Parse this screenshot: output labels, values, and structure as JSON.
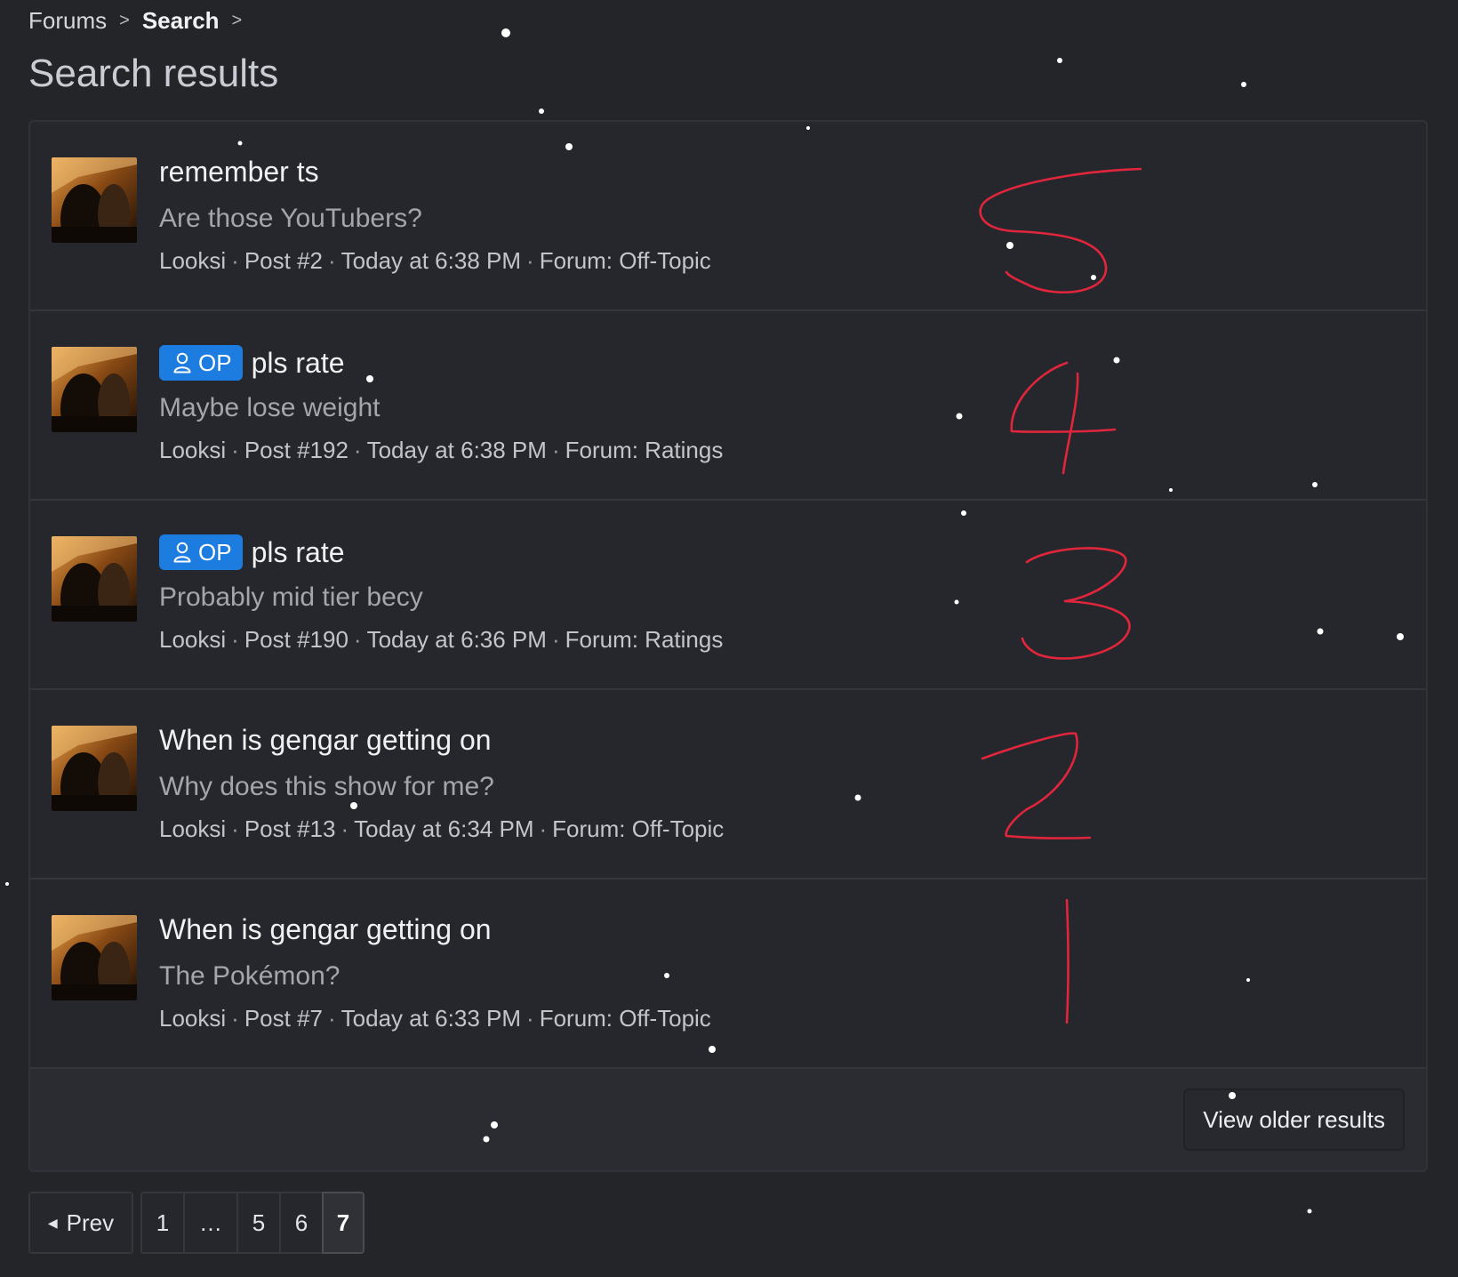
{
  "breadcrumb": {
    "items": [
      "Forums",
      "Search"
    ],
    "separator": ">"
  },
  "page": {
    "title": "Search results"
  },
  "results": [
    {
      "title": "remember ts",
      "op": false,
      "snippet": "Are those YouTubers?",
      "author": "Looksi",
      "post": "Post #2",
      "time": "Today at 6:38 PM",
      "forum": "Forum: Off-Topic"
    },
    {
      "title": "pls rate",
      "op": true,
      "snippet": "Maybe lose weight",
      "author": "Looksi",
      "post": "Post #192",
      "time": "Today at 6:38 PM",
      "forum": "Forum: Ratings"
    },
    {
      "title": "pls rate",
      "op": true,
      "snippet": "Probably mid tier becy",
      "author": "Looksi",
      "post": "Post #190",
      "time": "Today at 6:36 PM",
      "forum": "Forum: Ratings"
    },
    {
      "title": "When is gengar getting on",
      "op": false,
      "snippet": "Why does this show for me?",
      "author": "Looksi",
      "post": "Post #13",
      "time": "Today at 6:34 PM",
      "forum": "Forum: Off-Topic"
    },
    {
      "title": "When is gengar getting on",
      "op": false,
      "snippet": "The Pokémon?",
      "author": "Looksi",
      "post": "Post #7",
      "time": "Today at 6:33 PM",
      "forum": "Forum: Off-Topic"
    }
  ],
  "op_badge_label": "OP",
  "meta_separator": "·",
  "view_older_label": "View older results",
  "pagination": {
    "prev_label": "Prev",
    "pages": [
      "1",
      "…",
      "5",
      "6",
      "7"
    ],
    "current": "7"
  },
  "annotations": [
    "5",
    "4",
    "3",
    "2",
    "1"
  ],
  "colors": {
    "background": "#242529",
    "accent": "#1c7ce0",
    "annotation_ink": "#e0253c"
  },
  "icons": {
    "op": "user-icon",
    "prev": "caret-left-icon",
    "breadcrumb_separator": "chevron-right-icon"
  }
}
